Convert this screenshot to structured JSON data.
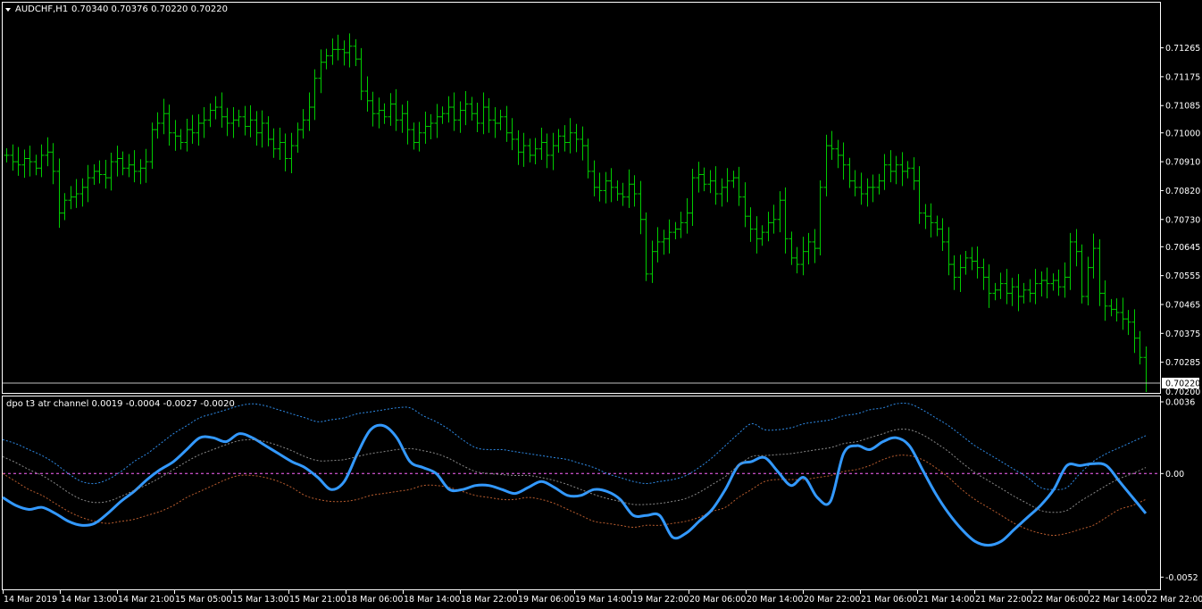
{
  "chart_data": [
    {
      "type": "ohlc",
      "title": "AUDCHF,H1",
      "ohlc_values": "0.70340 0.70376 0.70220 0.70220",
      "ylim": [
        0.7022,
        0.71325
      ],
      "yticks": [
        "0.71265",
        "0.71175",
        "0.71085",
        "0.71000",
        "0.70910",
        "0.70820",
        "0.70730",
        "0.70645",
        "0.70555",
        "0.70465",
        "0.70375",
        "0.70285"
      ],
      "current_price": "0.70220",
      "axis_bottom_label": "0.70200",
      "bar_color": "#00cc00",
      "close": [
        0.7093,
        0.7091,
        0.709,
        0.7092,
        0.7091,
        0.7089,
        0.7093,
        0.7094,
        0.7088,
        0.7075,
        0.7079,
        0.708,
        0.7081,
        0.7083,
        0.7086,
        0.7088,
        0.7087,
        0.7086,
        0.7091,
        0.7092,
        0.7089,
        0.709,
        0.7088,
        0.7089,
        0.7091,
        0.7101,
        0.7103,
        0.7106,
        0.71,
        0.7099,
        0.7097,
        0.7101,
        0.71,
        0.7103,
        0.7104,
        0.7107,
        0.7108,
        0.7105,
        0.7103,
        0.7104,
        0.7105,
        0.7102,
        0.7104,
        0.71,
        0.7103,
        0.7098,
        0.7095,
        0.7097,
        0.7092,
        0.7096,
        0.7101,
        0.7104,
        0.7108,
        0.7117,
        0.7122,
        0.7124,
        0.7126,
        0.7126,
        0.7125,
        0.7127,
        0.7123,
        0.7113,
        0.711,
        0.7106,
        0.7107,
        0.7105,
        0.7109,
        0.7104,
        0.7106,
        0.7101,
        0.7097,
        0.71,
        0.7102,
        0.7103,
        0.7105,
        0.7106,
        0.7108,
        0.7104,
        0.7107,
        0.7109,
        0.7106,
        0.7103,
        0.7108,
        0.7104,
        0.7103,
        0.7105,
        0.71,
        0.7098,
        0.7094,
        0.7096,
        0.7093,
        0.7095,
        0.7097,
        0.7093,
        0.7096,
        0.7099,
        0.7097,
        0.71,
        0.7098,
        0.7096,
        0.7088,
        0.7083,
        0.7082,
        0.7085,
        0.7083,
        0.7081,
        0.708,
        0.7084,
        0.7081,
        0.7073,
        0.7056,
        0.7063,
        0.7066,
        0.7067,
        0.7069,
        0.707,
        0.7072,
        0.7075,
        0.7086,
        0.7087,
        0.7084,
        0.7085,
        0.7081,
        0.7083,
        0.7085,
        0.7086,
        0.708,
        0.7074,
        0.707,
        0.7067,
        0.7069,
        0.7072,
        0.7073,
        0.7079,
        0.7067,
        0.7061,
        0.7059,
        0.7063,
        0.7066,
        0.7064,
        0.7083,
        0.7096,
        0.7095,
        0.7093,
        0.709,
        0.7085,
        0.7083,
        0.7081,
        0.7083,
        0.7083,
        0.7085,
        0.709,
        0.7088,
        0.709,
        0.7088,
        0.7089,
        0.7085,
        0.7075,
        0.7074,
        0.7072,
        0.707,
        0.7066,
        0.7059,
        0.7055,
        0.7058,
        0.7061,
        0.706,
        0.7058,
        0.7055,
        0.705,
        0.7051,
        0.7053,
        0.705,
        0.7052,
        0.7049,
        0.7051,
        0.705,
        0.7053,
        0.7054,
        0.7053,
        0.7054,
        0.7052,
        0.7055,
        0.7066,
        0.7063,
        0.7049,
        0.7058,
        0.7064,
        0.705,
        0.7046,
        0.7045,
        0.7044,
        0.7042,
        0.7041,
        0.7036,
        0.703,
        0.7022
      ]
    },
    {
      "type": "line",
      "title": "dpo t3 atr channel 0.0019 -0.0004 -0.0027 -0.0020",
      "ylim": [
        -0.0055,
        0.0036
      ],
      "yticks": [
        "0.0036",
        "0.00",
        "-0.0052"
      ],
      "zero_line_color": "#ff66ff",
      "series": [
        {
          "color": "#3399ff",
          "values": [
            -0.0012,
            -0.0016,
            -0.0018,
            -0.0017,
            -0.002,
            -0.0024,
            -0.0026,
            -0.0025,
            -0.002,
            -0.0014,
            -0.0009,
            -0.0003,
            0.0002,
            0.0006,
            0.0012,
            0.0018,
            0.0018,
            0.0016,
            0.002,
            0.0018,
            0.0014,
            0.001,
            0.0006,
            0.0003,
            -0.0002,
            -0.0008,
            -0.0004,
            0.001,
            0.0022,
            0.0024,
            0.0018,
            0.0006,
            0.0003,
            0.0,
            -0.0008,
            -0.0008,
            -0.0006,
            -0.0006,
            -0.0008,
            -0.001,
            -0.0007,
            -0.0004,
            -0.0007,
            -0.0011,
            -0.0011,
            -0.0008,
            -0.0009,
            -0.0013,
            -0.0021,
            -0.0021,
            -0.0021,
            -0.0032,
            -0.003,
            -0.0024,
            -0.0018,
            -0.0008,
            0.0004,
            0.0006,
            0.0008,
            0.0001,
            -0.0006,
            -0.0002,
            -0.0012,
            -0.0014,
            0.001,
            0.0014,
            0.0012,
            0.0016,
            0.0018,
            0.0014,
            0.0002,
            -0.001,
            -0.002,
            -0.0028,
            -0.0034,
            -0.0036,
            -0.0034,
            -0.0028,
            -0.0022,
            -0.0016,
            -0.0008,
            0.0004,
            0.0004,
            0.0005,
            0.0004,
            -0.0004,
            -0.0012,
            -0.002
          ]
        },
        {
          "color": "#3399ff",
          "dashed": true,
          "values": [
            0.0017,
            0.0015,
            0.0012,
            0.0009,
            0.0005,
            0.0,
            -0.0004,
            -0.0005,
            -0.0003,
            0.0001,
            0.0006,
            0.001,
            0.0015,
            0.002,
            0.0024,
            0.0028,
            0.003,
            0.0032,
            0.0034,
            0.0035,
            0.0034,
            0.0032,
            0.003,
            0.0028,
            0.0026,
            0.0027,
            0.0028,
            0.003,
            0.0031,
            0.0032,
            0.0033,
            0.0033,
            0.0029,
            0.0026,
            0.0022,
            0.0017,
            0.0013,
            0.0012,
            0.0012,
            0.0011,
            0.001,
            0.0009,
            0.0008,
            0.0007,
            0.0005,
            0.0003,
            0.0,
            -0.0002,
            -0.0004,
            -0.0005,
            -0.0004,
            -0.0003,
            -0.0001,
            0.0003,
            0.0008,
            0.0014,
            0.002,
            0.0025,
            0.0022,
            0.0022,
            0.0023,
            0.0025,
            0.0026,
            0.0027,
            0.0029,
            0.003,
            0.0032,
            0.0033,
            0.0035,
            0.0035,
            0.0032,
            0.0028,
            0.0024,
            0.0019,
            0.0014,
            0.001,
            0.0006,
            0.0002,
            -0.0002,
            -0.0007,
            -0.0008,
            -0.0007,
            0.0,
            0.0006,
            0.001,
            0.0013,
            0.0016,
            0.0019
          ]
        },
        {
          "color": "#cc6633",
          "dashed": true,
          "values": [
            0.0,
            -0.0004,
            -0.0008,
            -0.0011,
            -0.0015,
            -0.0019,
            -0.0022,
            -0.0024,
            -0.0025,
            -0.0024,
            -0.0023,
            -0.0021,
            -0.0019,
            -0.0016,
            -0.0012,
            -0.0009,
            -0.0006,
            -0.0003,
            -0.0001,
            -0.0001,
            -0.0002,
            -0.0004,
            -0.0007,
            -0.0011,
            -0.0013,
            -0.0014,
            -0.0014,
            -0.0013,
            -0.0011,
            -0.001,
            -0.0009,
            -0.0008,
            -0.0006,
            -0.0006,
            -0.0007,
            -0.0009,
            -0.0011,
            -0.0012,
            -0.0013,
            -0.0013,
            -0.0012,
            -0.0013,
            -0.0015,
            -0.0018,
            -0.0021,
            -0.0024,
            -0.0025,
            -0.0026,
            -0.0027,
            -0.0026,
            -0.0026,
            -0.0025,
            -0.0024,
            -0.0022,
            -0.0019,
            -0.0017,
            -0.0012,
            -0.0008,
            -0.0004,
            -0.0003,
            -0.0003,
            -0.0003,
            -0.0002,
            -0.0001,
            0.0001,
            0.0002,
            0.0004,
            0.0007,
            0.0009,
            0.0009,
            0.0007,
            0.0003,
            -0.0002,
            -0.0008,
            -0.0013,
            -0.0017,
            -0.0021,
            -0.0025,
            -0.0028,
            -0.003,
            -0.0031,
            -0.003,
            -0.0028,
            -0.0026,
            -0.0022,
            -0.0018,
            -0.0016,
            -0.0013
          ]
        }
      ]
    }
  ],
  "x_axis_labels": [
    "14 Mar 2019",
    "14 Mar 13:00",
    "14 Mar 21:00",
    "15 Mar 05:00",
    "15 Mar 13:00",
    "15 Mar 21:00",
    "18 Mar 06:00",
    "18 Mar 14:00",
    "18 Mar 22:00",
    "19 Mar 06:00",
    "19 Mar 14:00",
    "19 Mar 22:00",
    "20 Mar 06:00",
    "20 Mar 14:00",
    "20 Mar 22:00",
    "21 Mar 06:00",
    "21 Mar 14:00",
    "21 Mar 22:00",
    "22 Mar 06:00",
    "22 Mar 14:00",
    "22 Mar 22:00"
  ]
}
